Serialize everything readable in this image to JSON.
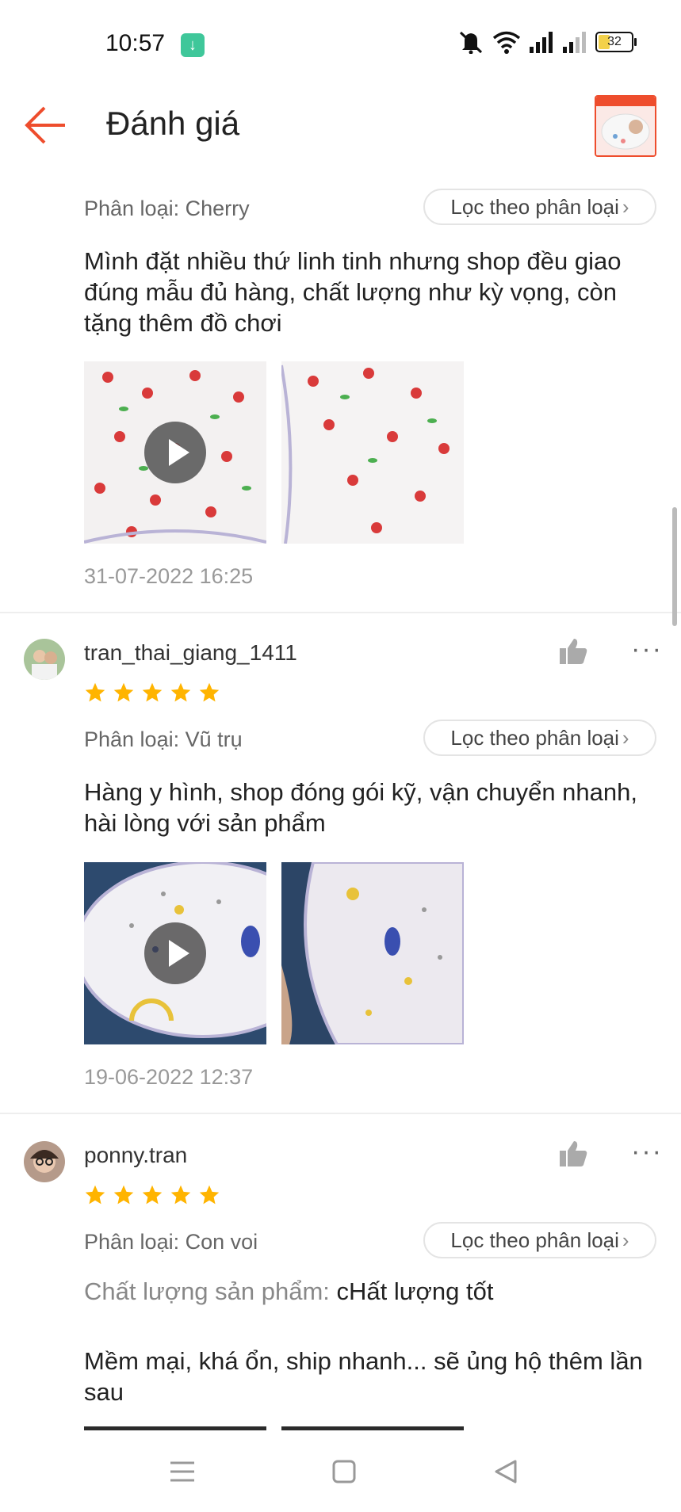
{
  "status_bar": {
    "time": "10:57",
    "battery": "32"
  },
  "header": {
    "title": "Đánh giá"
  },
  "reviews": [
    {
      "variant": "Phân loại: Cherry",
      "filter_label": "Lọc theo phân loại",
      "text": "Mình đặt nhiều thứ linh tinh nhưng shop đều giao đúng mẫu đủ hàng, chất lượng như kỳ vọng, còn tặng thêm đồ chơi",
      "date": "31-07-2022 16:25"
    },
    {
      "username": "tran_thai_giang_1411",
      "rating": 5,
      "variant": "Phân loại: Vũ trụ",
      "filter_label": "Lọc theo phân loại",
      "text": "Hàng y hình, shop đóng gói kỹ, vận chuyển nhanh, hài lòng với sản phẩm",
      "date": "19-06-2022 12:37"
    },
    {
      "username": "ponny.tran",
      "rating": 5,
      "variant": "Phân loại: Con voi",
      "filter_label": "Lọc theo phân loại",
      "quality_label": "Chất lượng sản phẩm:",
      "quality_value": "cHất lượng tốt",
      "text": "Mềm mại, khá ổn, ship nhanh... sẽ ủng hộ thêm lần sau"
    }
  ],
  "colors": {
    "accent": "#ee4d2d",
    "star": "#ffb400"
  }
}
